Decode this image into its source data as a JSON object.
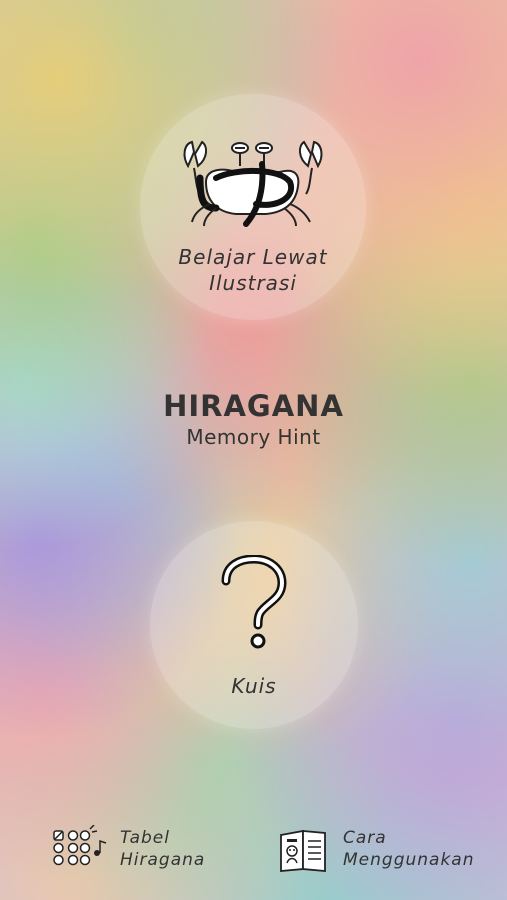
{
  "header": {
    "title": "HIRAGANA",
    "subtitle": "Memory Hint"
  },
  "illustration_button": {
    "label": "Belajar Lewat\nIlustrasi",
    "icon": "crab-icon"
  },
  "quiz_button": {
    "label": "Kuis",
    "icon": "question-mark-icon"
  },
  "bottom_nav": {
    "table": {
      "label": "Tabel\nHiragana",
      "icon": "hiragana-grid-icon"
    },
    "howto": {
      "label": "Cara\nMenggunakan",
      "icon": "book-icon"
    }
  }
}
